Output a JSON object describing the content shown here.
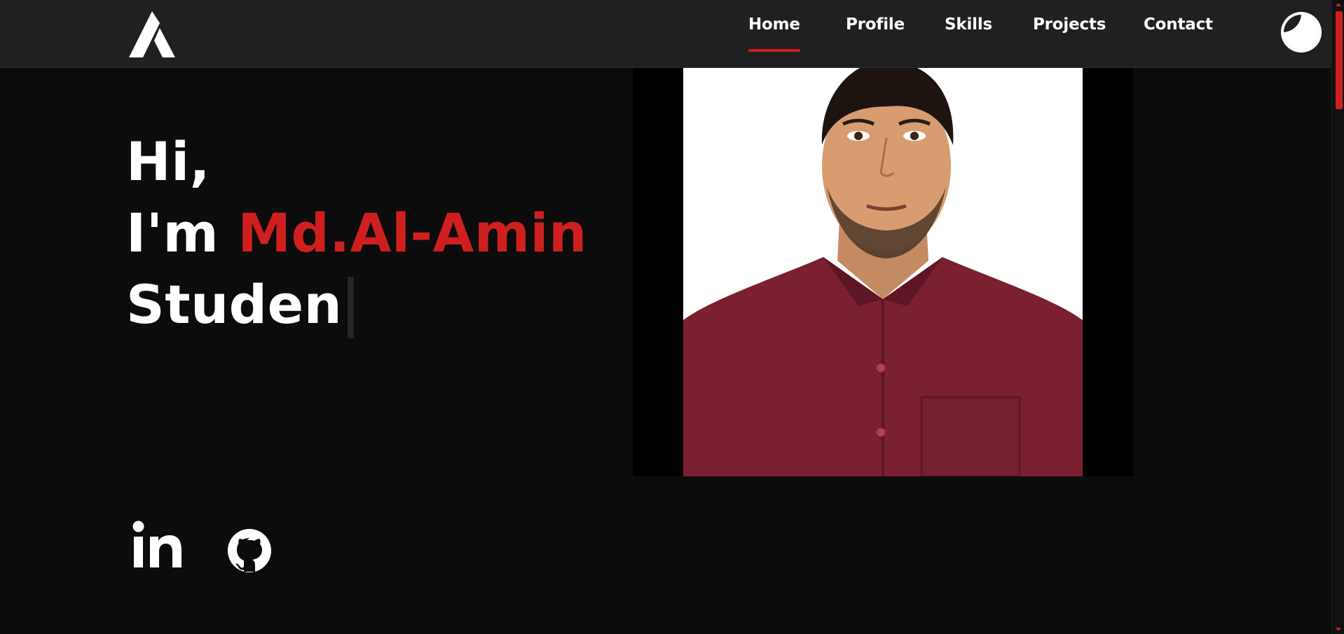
{
  "nav": {
    "logo_icon": "a-monogram-logo",
    "links": [
      {
        "label": "Home",
        "active": true
      },
      {
        "label": "Profile"
      },
      {
        "label": "Skills"
      },
      {
        "label": "Projects"
      },
      {
        "label": "Contact"
      }
    ],
    "theme_toggle_icon": "half-moon-icon"
  },
  "hero": {
    "greeting": "Hi,",
    "intro": "I'm",
    "name": "Md.Al-Amin",
    "typed_text": "Studen"
  },
  "photo": {
    "icon": "profile-photo"
  },
  "socials": [
    {
      "icon": "linkedin-icon"
    },
    {
      "icon": "github-icon"
    }
  ],
  "colors": {
    "accent": "#cf1f1f",
    "background": "#0c0c0c",
    "navbar": "#202020",
    "text": "#ffffff"
  }
}
